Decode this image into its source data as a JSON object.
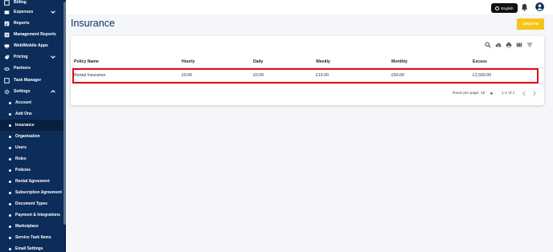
{
  "sidebar": {
    "top_items": [
      {
        "label": "Billing",
        "icon": "billing-icon"
      },
      {
        "label": "Expenses",
        "icon": "expenses-icon"
      },
      {
        "label": "Reports",
        "icon": "reports-icon"
      },
      {
        "label": "Management Reports",
        "icon": "management-reports-icon"
      },
      {
        "label": "Web/Mobile Apps",
        "icon": "apps-icon"
      },
      {
        "label": "Pricing",
        "icon": "pricing-icon"
      },
      {
        "label": "Partners",
        "icon": "partners-icon"
      },
      {
        "label": "Task Manager",
        "icon": "task-manager-icon"
      },
      {
        "label": "Settings",
        "icon": "settings-icon"
      }
    ],
    "settings_items": [
      "Account",
      "Add Ons",
      "Insurance",
      "Organisation",
      "Users",
      "Roles",
      "Policies",
      "Rental Agreement",
      "Subscription Agreement",
      "Document Types",
      "Payment & Integrations",
      "Marketplace",
      "Service Task Items",
      "Email Settings"
    ],
    "active_item": "Insurance"
  },
  "topbar": {
    "language_label": "English"
  },
  "page": {
    "title": "Insurance",
    "create_label": "CREATE"
  },
  "table": {
    "columns": [
      "Policy Name",
      "Hourly",
      "Daily",
      "Weekly",
      "Monthly",
      "Excess"
    ],
    "rows": [
      [
        "Rental Insurance",
        "£0.00",
        "£0.00",
        "£10.00",
        "£50.00",
        "£1,500.00"
      ]
    ],
    "footer": {
      "rows_per_page_label": "Rows per page:",
      "rows_per_page_value": "15",
      "range_label": "1-1 of 1"
    }
  },
  "colors": {
    "sidebar_bg": "#0c2d5a",
    "accent": "#f5c518",
    "highlight_border": "#e30b17",
    "title_color": "#0c2d5a"
  }
}
